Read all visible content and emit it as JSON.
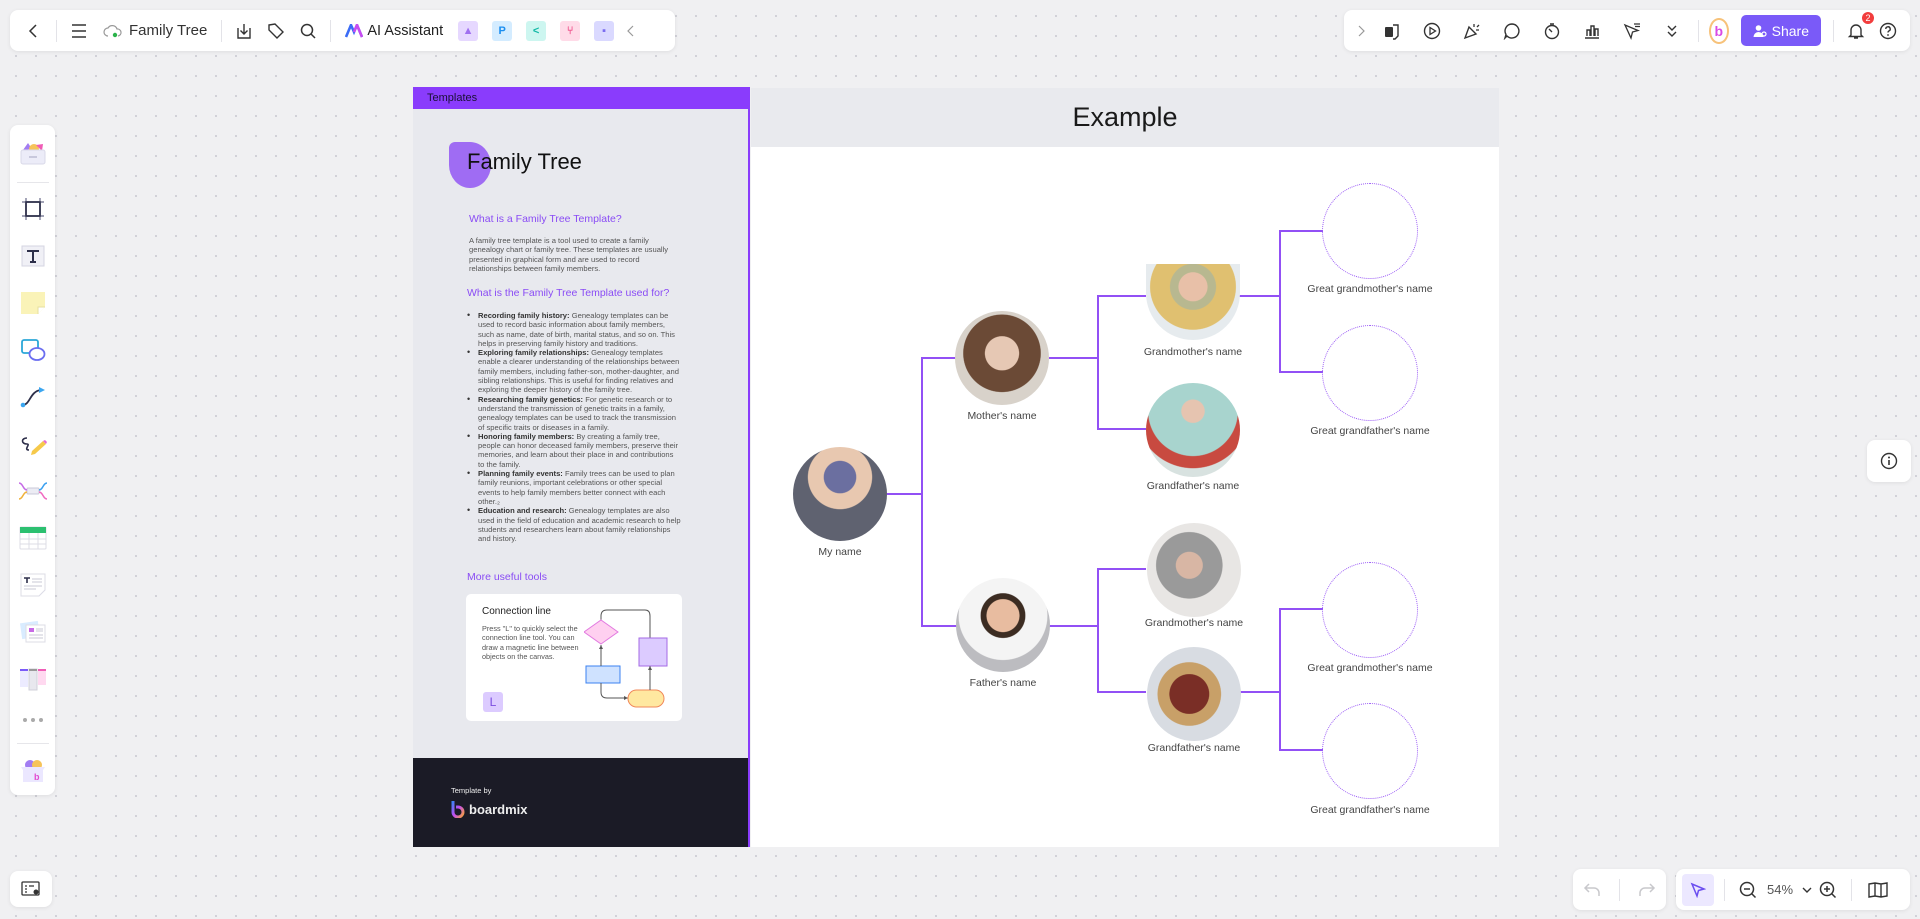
{
  "toolbar_left": {
    "back_icon": "chevron-left-icon",
    "menu_icon": "hamburger-icon",
    "doc_title": "Family Tree",
    "cloud_icon": "cloud-saved-icon",
    "download_icon": "download-icon",
    "tag_icon": "tag-icon",
    "search_icon": "search-icon",
    "ai_label": "AI Assistant",
    "plugins": [
      "image-gen",
      "P",
      "mindmap",
      "flow",
      "chat"
    ],
    "collapse_icon": "chevron-left-icon"
  },
  "toolbar_right": {
    "expand_icon": "chevron-right-icon",
    "tools": [
      "template",
      "present",
      "celebrate",
      "comment",
      "timer",
      "chart",
      "laser-pointer",
      "more"
    ],
    "share_label": "Share",
    "notification_count": "2",
    "help_icon": "help-icon"
  },
  "tool_dock": {
    "items": [
      "Templates",
      "Frame",
      "Text",
      "Sticky note",
      "Shape",
      "Connector",
      "Pen",
      "Mind map",
      "Table",
      "Document",
      "Card",
      "Kanban",
      "More",
      "Boardmix apps"
    ]
  },
  "template": {
    "header": "Templates",
    "title": "Family Tree",
    "h1": "What is a Family Tree Template?",
    "p1": "A family tree template is a tool used to create a family genealogy chart or family tree. These templates are usually presented in graphical form and are used to record relationships between family members.",
    "h2": "What is the Family Tree Template used for?",
    "uses": [
      {
        "title": "Recording family history:",
        "text": " Genealogy templates can be used to record basic information about family members, such as name, date of birth, marital status, and so on. This helps in preserving family history and traditions."
      },
      {
        "title": "Exploring family relationships:",
        "text": " Genealogy templates enable a clearer understanding of the relationships between family members, including father-son, mother-daughter, and sibling relationships. This is useful for finding relatives and exploring the deeper history of the family tree."
      },
      {
        "title": "Researching family genetics:",
        "text": " For genetic research or to understand the transmission of genetic traits in a family, genealogy templates can be used to track the transmission of specific traits or diseases in a family."
      },
      {
        "title": "Honoring family members:",
        "text": " By creating a family tree, people can honor deceased family members, preserve their memories, and learn about their place in and contributions to the family."
      },
      {
        "title": "Planning family events:",
        "text": " Family trees can be used to plan family reunions, important celebrations or other special events to help family members better connect with each other.₂"
      },
      {
        "title": "Education and research:",
        "text": " Genealogy templates are also used in the field of education and academic research to help students and researchers learn about family relationships and history."
      }
    ],
    "h3": "More useful tools",
    "tool_card": {
      "title": "Connection line",
      "desc": "Press \"L\" to quickly select the connection line tool. You can draw a magnetic line between objects on the canvas.",
      "key": "L"
    },
    "footer_by": "Template by",
    "footer_brand": "boardmix"
  },
  "example": {
    "title": "Example",
    "me": "My name",
    "mother": "Mother's name",
    "father": "Father's name",
    "maternal_grandmother": "Grandmother's name",
    "maternal_grandfather": "Grandfather's name",
    "paternal_grandmother": "Grandmother's name",
    "paternal_grandfather": "Grandfather's name",
    "great_grandmother_1": "Great grandmother's name",
    "great_grandfather_1": "Great grandfather's name",
    "great_grandmother_2": "Great grandmother's name",
    "great_grandfather_2": "Great grandfather's name"
  },
  "bottom": {
    "zoom_level": "54%"
  },
  "colors": {
    "accent": "#8a3cfc",
    "share": "#7a5af8",
    "connector": "#9250f5"
  }
}
